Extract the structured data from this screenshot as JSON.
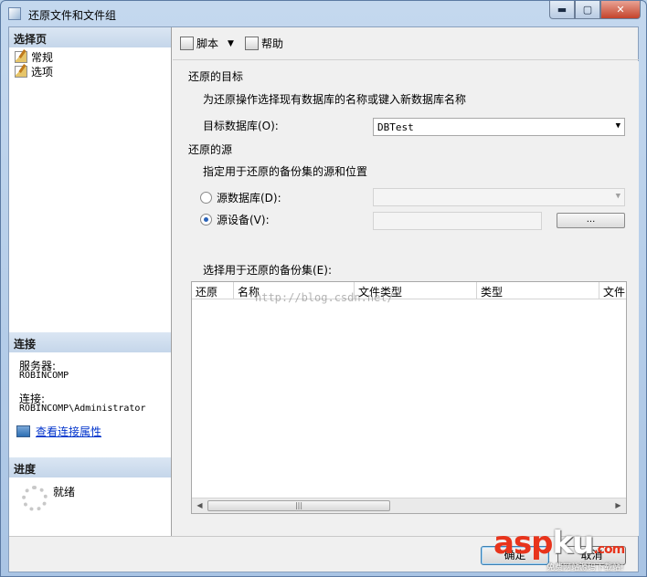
{
  "window": {
    "title": "还原文件和文件组",
    "controls": {
      "minimize": "▬",
      "maximize": "▢",
      "close": "✕"
    }
  },
  "left_pane": {
    "select_page_header": "选择页",
    "pages": [
      {
        "label": "常规",
        "icon": "page-icon"
      },
      {
        "label": "选项",
        "icon": "page-icon"
      }
    ],
    "connection_header": "连接",
    "server_label": "服务器:",
    "server_value": "ROBINCOMP",
    "connection_label": "连接:",
    "connection_value": "ROBINCOMP\\Administrator",
    "view_connection_link": "查看连接属性",
    "progress_header": "进度",
    "progress_status": "就绪"
  },
  "toolbar": {
    "script_label": "脚本",
    "script_caret": "▼",
    "help_label": "帮助"
  },
  "form": {
    "destination_heading": "还原的目标",
    "destination_desc": "为还原操作选择现有数据库的名称或键入新数据库名称",
    "target_db_label": "目标数据库(O):",
    "target_db_value": "DBTest",
    "combo_arrow": "▼",
    "source_heading": "还原的源",
    "source_desc": "指定用于还原的备份集的源和位置",
    "radio_source_db": "源数据库(D):",
    "radio_source_device": "源设备(V):",
    "browse_button": "...",
    "backup_sets_label": "选择用于还原的备份集(E):",
    "grid_columns": [
      "还原",
      "名称",
      "文件类型",
      "类型",
      "文件"
    ],
    "url_watermark": "http://blog.csdn.net/",
    "scroll_left": "◀",
    "scroll_right": "▶",
    "scroll_thumb": "|||"
  },
  "buttons": {
    "ok": "确定",
    "cancel": "取消"
  },
  "watermark": {
    "logo_a": "asp",
    "logo_b": "ku",
    "logo_c": ".com",
    "subtitle": "免费网站源码下载站!"
  },
  "colors": {
    "link": "#0033cc",
    "accent": "#e8341c",
    "header_bg": "#c5d6ea"
  }
}
